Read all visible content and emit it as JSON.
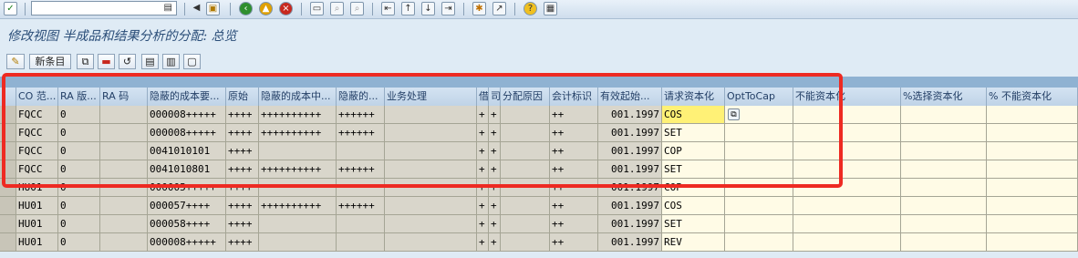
{
  "title": "修改视图 半成品和结果分析的分配: 总览",
  "command_field": {
    "value": ""
  },
  "app_toolbar": {
    "new_entries_label": "新条目"
  },
  "icons": {
    "enter": "check-icon",
    "command_dropdown": "dropdown-icon",
    "back": "back-icon",
    "save": "save-icon",
    "exit": "exit-icon",
    "cancel": "cancel-icon",
    "print": "print-icon",
    "find": "find-icon",
    "help": "help-icon"
  },
  "columns": [
    "CO 范...",
    "RA 版...",
    "RA 码",
    "隐蔽的成本要...",
    "原始",
    "隐蔽的成本中...",
    "隐蔽的...",
    "业务处理",
    "借",
    "司",
    "分配原因",
    "会计标识",
    "有效起始...",
    "请求资本化",
    "OptToCap",
    "不能资本化",
    "%选择资本化",
    "% 不能资本化"
  ],
  "rows": [
    [
      "FQCC",
      "0",
      "",
      "000008+++++",
      "++++",
      "++++++++++",
      "++++++",
      "",
      "+",
      "+",
      "",
      "++",
      "001.1997",
      "COS",
      "",
      "",
      "",
      ""
    ],
    [
      "FQCC",
      "0",
      "",
      "000008+++++",
      "++++",
      "++++++++++",
      "++++++",
      "",
      "+",
      "+",
      "",
      "++",
      "001.1997",
      "SET",
      "",
      "",
      "",
      ""
    ],
    [
      "FQCC",
      "0",
      "",
      "0041010101",
      "++++",
      "",
      "",
      "",
      "+",
      "+",
      "",
      "++",
      "001.1997",
      "COP",
      "",
      "",
      "",
      ""
    ],
    [
      "FQCC",
      "0",
      "",
      "0041010801",
      "++++",
      "++++++++++",
      "++++++",
      "",
      "+",
      "+",
      "",
      "++",
      "001.1997",
      "SET",
      "",
      "",
      "",
      ""
    ],
    [
      "HU01",
      "0",
      "",
      "000005+++++",
      "++++",
      "",
      "",
      "",
      "+",
      "+",
      "",
      "++",
      "001.1997",
      "COP",
      "",
      "",
      "",
      ""
    ],
    [
      "HU01",
      "0",
      "",
      "000057++++",
      "++++",
      "++++++++++",
      "++++++",
      "",
      "+",
      "+",
      "",
      "++",
      "001.1997",
      "COS",
      "",
      "",
      "",
      ""
    ],
    [
      "HU01",
      "0",
      "",
      "000058++++",
      "++++",
      "",
      "",
      "",
      "+",
      "+",
      "",
      "++",
      "001.1997",
      "SET",
      "",
      "",
      "",
      ""
    ],
    [
      "HU01",
      "0",
      "",
      "000008+++++",
      "++++",
      "",
      "",
      "",
      "+",
      "+",
      "",
      "++",
      "001.1997",
      "REV",
      "",
      "",
      "",
      ""
    ]
  ]
}
